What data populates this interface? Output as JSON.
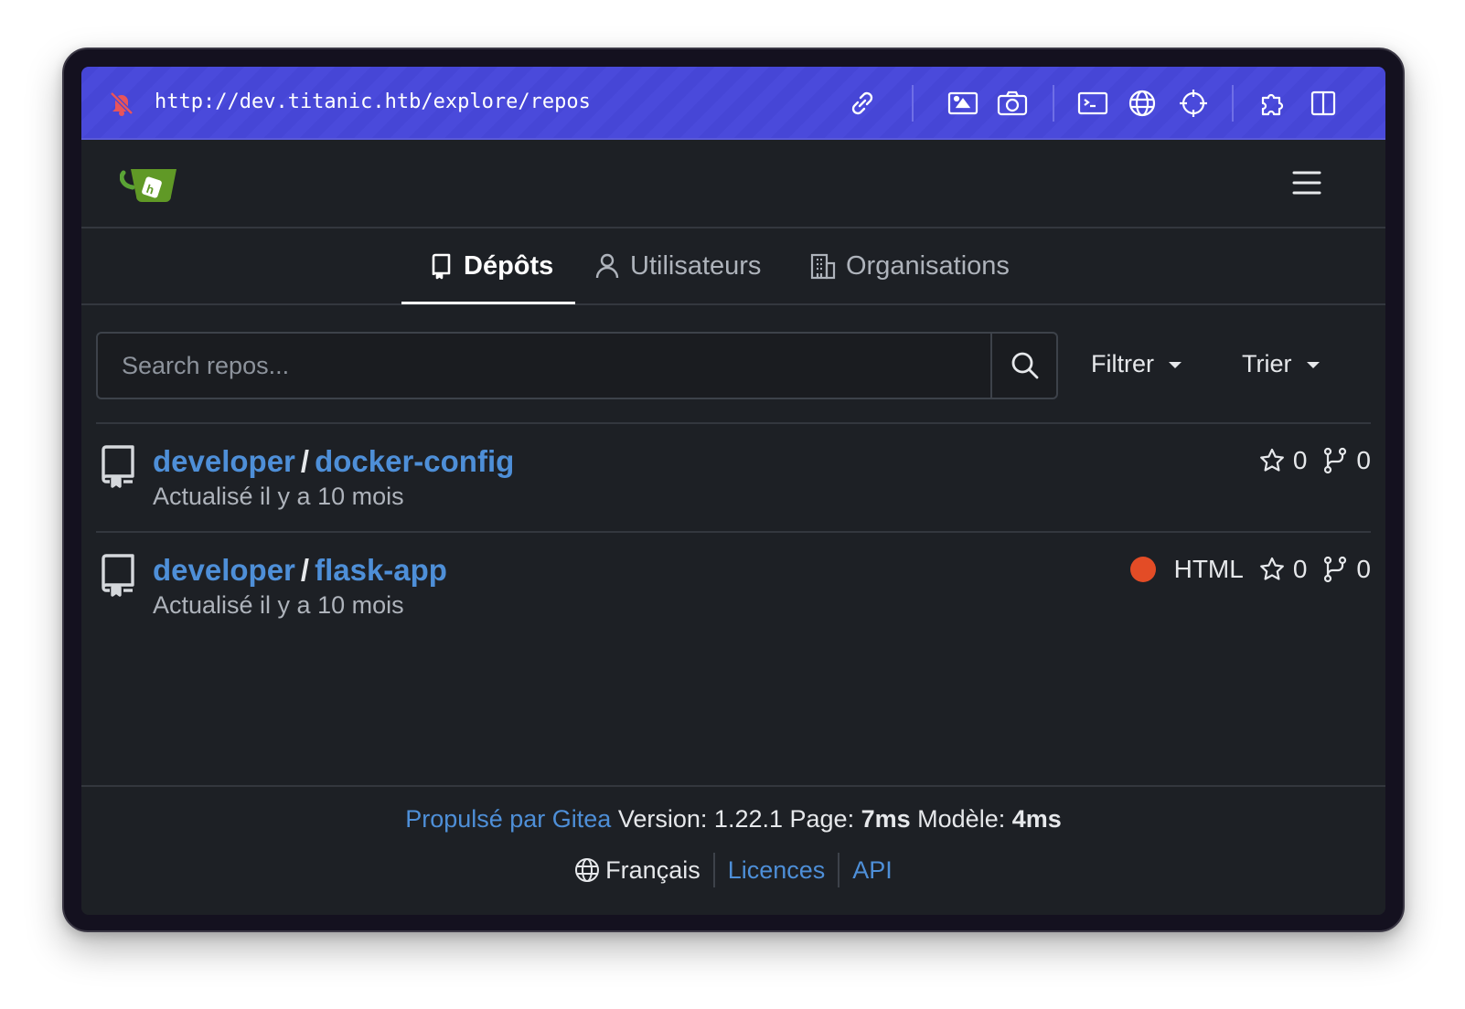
{
  "browser": {
    "url": "http://dev.titanic.htb/explore/repos"
  },
  "tabs": [
    {
      "label": "Dépôts",
      "active": true
    },
    {
      "label": "Utilisateurs",
      "active": false
    },
    {
      "label": "Organisations",
      "active": false
    }
  ],
  "search": {
    "placeholder": "Search repos...",
    "value": ""
  },
  "filters": {
    "filter_label": "Filtrer",
    "sort_label": "Trier"
  },
  "repos": [
    {
      "owner": "developer",
      "separator": "/",
      "name": "docker-config",
      "updated": "Actualisé il y a 10 mois",
      "language": "",
      "stars": "0",
      "forks": "0"
    },
    {
      "owner": "developer",
      "separator": "/",
      "name": "flask-app",
      "updated": "Actualisé il y a 10 mois",
      "language": "HTML",
      "language_color": "#e34c26",
      "stars": "0",
      "forks": "0"
    }
  ],
  "footer": {
    "powered_by": "Propulsé par Gitea",
    "version_label": "Version:",
    "version": "1.22.1",
    "page_label": "Page:",
    "page_time": "7ms",
    "template_label": "Modèle:",
    "template_time": "4ms",
    "language": "Français",
    "licenses": "Licences",
    "api": "API"
  },
  "colors": {
    "accent_bar": "#4646d6",
    "link": "#4e8fd8",
    "background": "#1d2025"
  }
}
